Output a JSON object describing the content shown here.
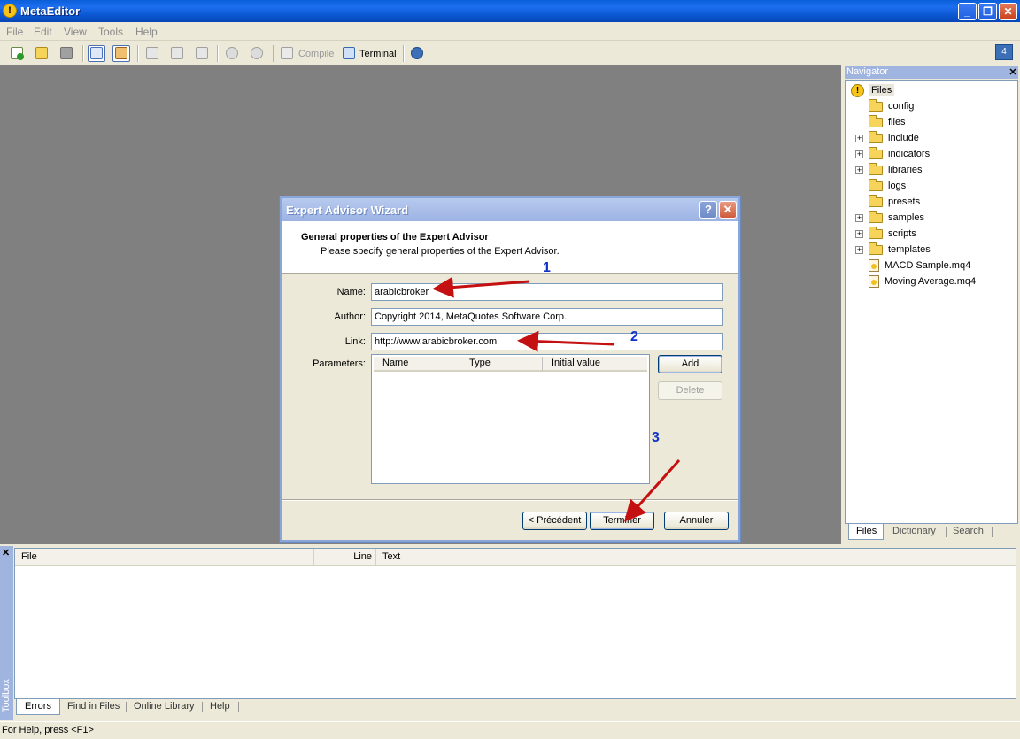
{
  "window": {
    "title": "MetaEditor",
    "app_icon": "!"
  },
  "menu": [
    "File",
    "Edit",
    "View",
    "Tools",
    "Help"
  ],
  "toolbar": {
    "compile_label": "Compile",
    "terminal_label": "Terminal",
    "badge": "4"
  },
  "navigator": {
    "title": "Navigator",
    "root": "Files",
    "items": [
      {
        "label": "config",
        "type": "folder",
        "expandable": false
      },
      {
        "label": "files",
        "type": "folder",
        "expandable": false
      },
      {
        "label": "include",
        "type": "folder",
        "expandable": true
      },
      {
        "label": "indicators",
        "type": "folder",
        "expandable": true
      },
      {
        "label": "libraries",
        "type": "folder",
        "expandable": true
      },
      {
        "label": "logs",
        "type": "folder",
        "expandable": false
      },
      {
        "label": "presets",
        "type": "folder",
        "expandable": false
      },
      {
        "label": "samples",
        "type": "folder",
        "expandable": true
      },
      {
        "label": "scripts",
        "type": "folder",
        "expandable": true
      },
      {
        "label": "templates",
        "type": "folder",
        "expandable": true
      },
      {
        "label": "MACD Sample.mq4",
        "type": "file",
        "expandable": false
      },
      {
        "label": "Moving Average.mq4",
        "type": "file",
        "expandable": false
      }
    ],
    "tabs": [
      "Files",
      "Dictionary",
      "Search"
    ]
  },
  "dialog": {
    "title": "Expert Advisor Wizard",
    "header_title": "General properties of the Expert Advisor",
    "header_subtitle": "Please specify general properties of the Expert Advisor.",
    "name_label": "Name:",
    "name_value": "arabicbroker",
    "author_label": "Author:",
    "author_value": "Copyright 2014, MetaQuotes Software Corp.",
    "link_label": "Link:",
    "link_value": "http://www.arabicbroker.com",
    "parameters_label": "Parameters:",
    "columns": [
      "Name",
      "Type",
      "Initial value"
    ],
    "add_label": "Add",
    "delete_label": "Delete",
    "back_label": "< Précédent",
    "finish_label": "Terminer",
    "cancel_label": "Annuler"
  },
  "annotations": [
    "1",
    "2",
    "3"
  ],
  "annotation_color": "#c41010",
  "toolbox": {
    "side_label": "Toolbox",
    "columns": [
      "File",
      "Line",
      "Text"
    ],
    "tabs": [
      "Errors",
      "Find in Files",
      "Online Library",
      "Help"
    ]
  },
  "status": {
    "text": "For Help, press <F1>"
  }
}
